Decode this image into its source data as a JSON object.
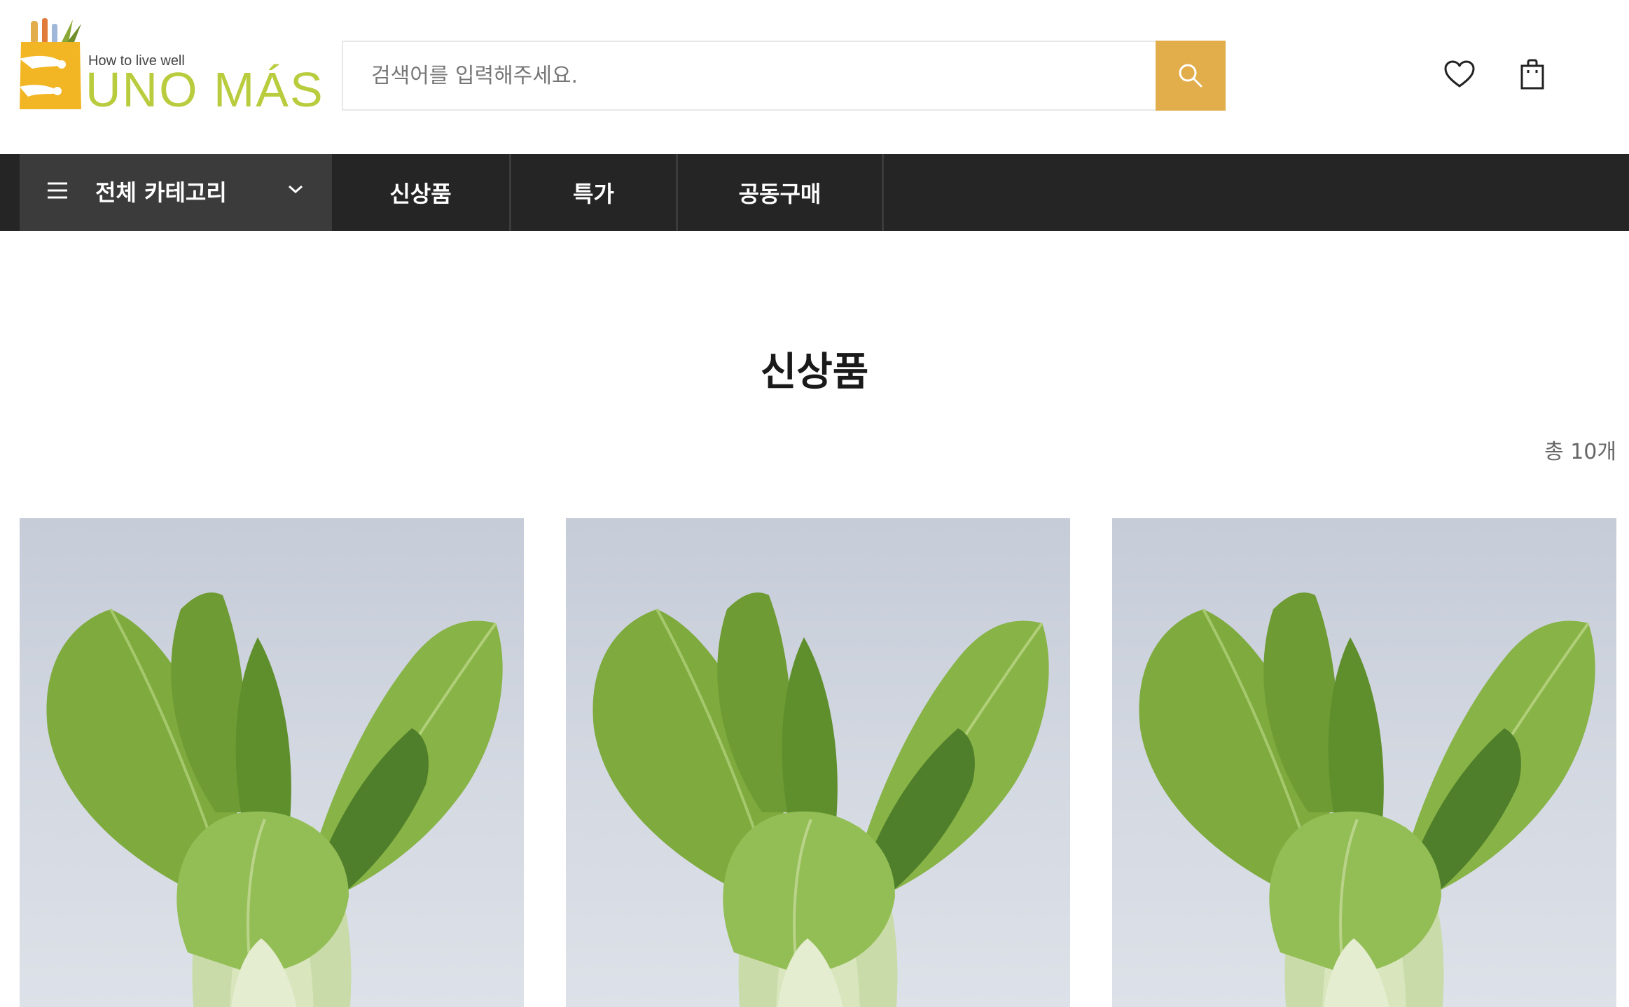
{
  "header": {
    "logo": {
      "tagline": "How to live well",
      "brand": "UNO MÁS"
    },
    "search": {
      "placeholder": "검색어를 입력해주세요.",
      "value": ""
    },
    "icons": {
      "search": "search-icon",
      "wishlist": "heart-icon",
      "cart": "shopping-bag-icon"
    }
  },
  "nav": {
    "category_label": "전체 카테고리",
    "items": [
      {
        "label": "신상품"
      },
      {
        "label": "특가"
      },
      {
        "label": "공동구매"
      }
    ]
  },
  "main": {
    "title": "신상품",
    "total_count": "총 10개",
    "products": [
      {
        "image": "bok-choy"
      },
      {
        "image": "bok-choy"
      },
      {
        "image": "bok-choy"
      }
    ]
  },
  "colors": {
    "accent": "#e2ad4b",
    "brand_green": "#b9cc3e",
    "nav_bg": "#252525",
    "nav_category_bg": "#3b3b3b"
  }
}
